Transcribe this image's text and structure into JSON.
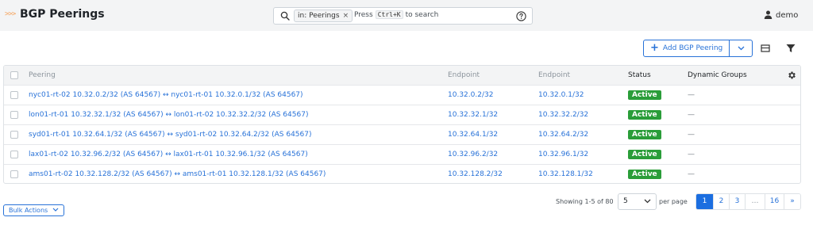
{
  "header": {
    "brand_mark": ">>>",
    "title": "BGP Peerings",
    "search": {
      "chip_label": "in: Peerings",
      "chip_close": "×",
      "hint_before": "Press",
      "hint_key": "Ctrl+K",
      "hint_after": "to search"
    },
    "user": {
      "name": "demo"
    }
  },
  "toolbar": {
    "add_label": "Add BGP Peering",
    "add_icon": "+"
  },
  "table": {
    "columns": [
      "Peering",
      "Endpoint",
      "Endpoint",
      "Status",
      "Dynamic Groups"
    ],
    "rows": [
      {
        "peering": "nyc01-rt-02 10.32.0.2/32 (AS 64567) ↔ nyc01-rt-01 10.32.0.1/32 (AS 64567)",
        "endpoint_a": "10.32.0.2/32",
        "endpoint_b": "10.32.0.1/32",
        "status": "Active",
        "groups": "—"
      },
      {
        "peering": "lon01-rt-01 10.32.32.1/32 (AS 64567) ↔ lon01-rt-02 10.32.32.2/32 (AS 64567)",
        "endpoint_a": "10.32.32.1/32",
        "endpoint_b": "10.32.32.2/32",
        "status": "Active",
        "groups": "—"
      },
      {
        "peering": "syd01-rt-01 10.32.64.1/32 (AS 64567) ↔ syd01-rt-02 10.32.64.2/32 (AS 64567)",
        "endpoint_a": "10.32.64.1/32",
        "endpoint_b": "10.32.64.2/32",
        "status": "Active",
        "groups": "—"
      },
      {
        "peering": "lax01-rt-02 10.32.96.2/32 (AS 64567) ↔ lax01-rt-01 10.32.96.1/32 (AS 64567)",
        "endpoint_a": "10.32.96.2/32",
        "endpoint_b": "10.32.96.1/32",
        "status": "Active",
        "groups": "—"
      },
      {
        "peering": "ams01-rt-02 10.32.128.2/32 (AS 64567) ↔ ams01-rt-01 10.32.128.1/32 (AS 64567)",
        "endpoint_a": "10.32.128.2/32",
        "endpoint_b": "10.32.128.1/32",
        "status": "Active",
        "groups": "—"
      }
    ]
  },
  "footer": {
    "bulk_actions": "Bulk Actions",
    "showing": "Showing 1-5 of 80",
    "per_page_value": "5",
    "per_page_label": "per page",
    "pages": [
      "1",
      "2",
      "3",
      "…",
      "16",
      "»"
    ],
    "active_page": "1"
  },
  "colors": {
    "accent": "#2872d8",
    "status_active": "#2a9d39",
    "brand": "#f5a35c"
  }
}
